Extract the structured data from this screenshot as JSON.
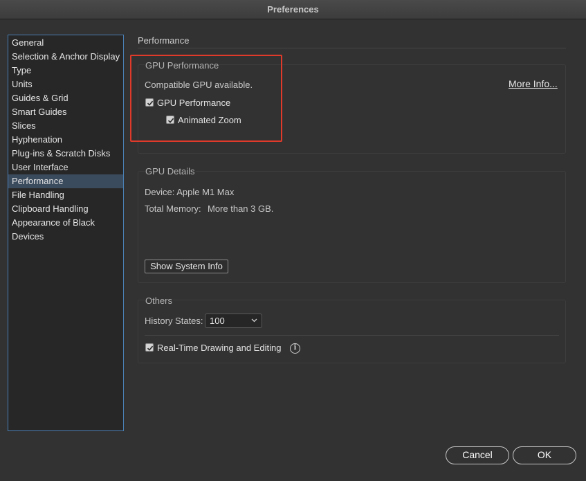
{
  "window": {
    "title": "Preferences"
  },
  "sidebar": {
    "items": [
      {
        "label": "General"
      },
      {
        "label": "Selection & Anchor Display"
      },
      {
        "label": "Type"
      },
      {
        "label": "Units"
      },
      {
        "label": "Guides & Grid"
      },
      {
        "label": "Smart Guides"
      },
      {
        "label": "Slices"
      },
      {
        "label": "Hyphenation"
      },
      {
        "label": "Plug-ins & Scratch Disks"
      },
      {
        "label": "User Interface"
      },
      {
        "label": "Performance"
      },
      {
        "label": "File Handling"
      },
      {
        "label": "Clipboard Handling"
      },
      {
        "label": "Appearance of Black"
      },
      {
        "label": "Devices"
      }
    ],
    "selected": "Performance"
  },
  "panel": {
    "title": "Performance",
    "gpu_performance": {
      "label": "GPU Performance",
      "status": "Compatible GPU available.",
      "more_info": "More Info...",
      "gpu_checkbox": {
        "label": "GPU Performance",
        "checked": true
      },
      "zoom_checkbox": {
        "label": "Animated Zoom",
        "checked": true
      }
    },
    "gpu_details": {
      "label": "GPU Details",
      "device": "Device: Apple M1 Max",
      "memory_label": "Total Memory:",
      "memory_value": "More than 3 GB.",
      "system_info_button": "Show System Info"
    },
    "others": {
      "label": "Others",
      "history_label": "History States:",
      "history_value": "100",
      "realtime_checkbox": {
        "label": "Real-Time Drawing and Editing",
        "checked": true
      },
      "info_icon_glyph": "i"
    }
  },
  "footer": {
    "cancel": "Cancel",
    "ok": "OK"
  },
  "colors": {
    "highlight": "#e03a2a",
    "selection": "#3b4b5e",
    "sidebar_border": "#4a7fb5"
  }
}
